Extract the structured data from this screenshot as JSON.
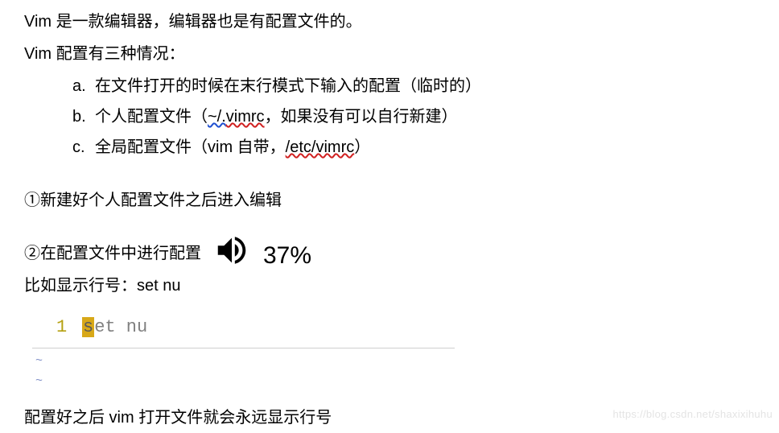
{
  "intro": {
    "line1": "Vim 是一款编辑器，编辑器也是有配置文件的。",
    "line2": "Vim 配置有三种情况："
  },
  "list": {
    "items": [
      {
        "marker": "a.",
        "text_before": "在文件打开的时候在末行模式下输入的配置（临时的）"
      },
      {
        "marker": "b.",
        "text_plain1": "个人配置文件（",
        "wavy_blue": "~/.",
        "wavy_red": "vimrc",
        "text_plain2": "，如果没有可以自行新建）"
      },
      {
        "marker": "c.",
        "text_plain1": "全局配置文件（vim 自带，",
        "wavy_red": "/etc/vimrc",
        "text_plain2": "）"
      }
    ]
  },
  "steps": {
    "s1": "①新建好个人配置文件之后进入编辑",
    "s2": "②在配置文件中进行配置",
    "example": "比如显示行号：set nu"
  },
  "volume": {
    "percent": "37%"
  },
  "code": {
    "line_num": "1",
    "cursor_char": "s",
    "rest": "et nu",
    "tilde": "~"
  },
  "final": "配置好之后 vim 打开文件就会永远显示行号",
  "watermark": "https://blog.csdn.net/shaxixihuhu"
}
